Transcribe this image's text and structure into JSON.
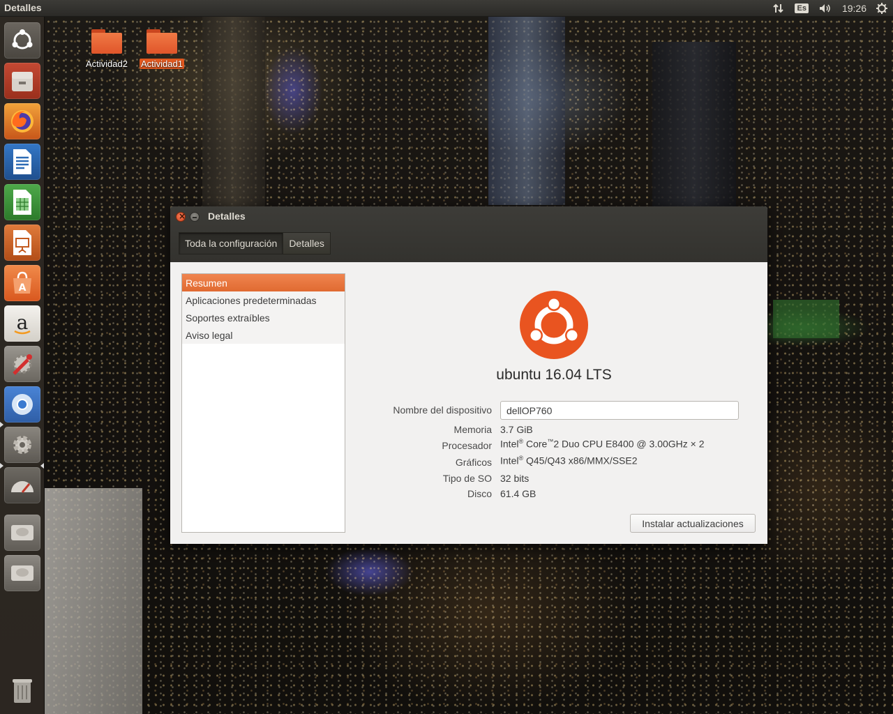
{
  "top_panel": {
    "title": "Detalles",
    "keyboard_layout": "Es",
    "clock": "19:26",
    "icons": [
      "network-arrows-icon",
      "keyboard-layout-icon",
      "volume-icon",
      "system-gear-icon"
    ]
  },
  "launcher": {
    "items": [
      {
        "name": "ubuntu-dash"
      },
      {
        "name": "file-manager"
      },
      {
        "name": "firefox"
      },
      {
        "name": "libreoffice-writer"
      },
      {
        "name": "libreoffice-calc"
      },
      {
        "name": "libreoffice-impress"
      },
      {
        "name": "software-center"
      },
      {
        "name": "amazon"
      },
      {
        "name": "system-tools"
      },
      {
        "name": "chromium"
      },
      {
        "name": "system-settings"
      },
      {
        "name": "disk-usage"
      },
      {
        "name": "drive-1"
      },
      {
        "name": "drive-2"
      },
      {
        "name": "trash"
      }
    ]
  },
  "desktop": {
    "icons": [
      {
        "label": "Actividad2",
        "selected": false
      },
      {
        "label": "Actividad1",
        "selected": true
      }
    ]
  },
  "window": {
    "title": "Detalles",
    "tabs": [
      {
        "label": "Toda la configuración",
        "active": true
      },
      {
        "label": "Detalles",
        "active": false
      }
    ],
    "sidebar": {
      "items": [
        {
          "label": "Resumen",
          "active": true
        },
        {
          "label": "Aplicaciones predeterminadas",
          "active": false
        },
        {
          "label": "Soportes extraíbles",
          "active": false
        },
        {
          "label": "Aviso legal",
          "active": false
        }
      ]
    },
    "summary": {
      "distro": "ubuntu 16.04 LTS",
      "device_name_label": "Nombre del dispositivo",
      "device_name_value": "dellOP760",
      "memory_label": "Memoria",
      "memory_value": "3.7 GiB",
      "processor_label": "Procesador",
      "processor_brand": "Intel",
      "processor_reg": "®",
      "processor_line": "Core",
      "processor_tm": "™",
      "processor_rest": "2 Duo CPU E8400 @ 3.00GHz × 2",
      "graphics_label": "Gráficos",
      "graphics_brand": "Intel",
      "graphics_reg": "®",
      "graphics_rest": "Q45/Q43 x86/MMX/SSE2",
      "os_type_label": "Tipo de SO",
      "os_type_value": "32 bits",
      "disk_label": "Disco",
      "disk_value": "61.4 GB",
      "update_button": "Instalar actualizaciones"
    },
    "accent_color": "#e95420"
  }
}
